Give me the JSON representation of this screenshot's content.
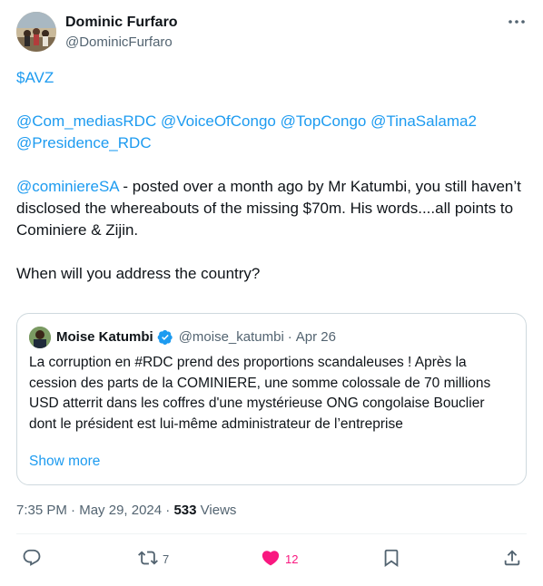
{
  "author": {
    "display_name": "Dominic Furfaro",
    "handle": "@DominicFurfaro"
  },
  "tweet": {
    "cashtag": "$AVZ",
    "mentions": [
      "@Com_mediasRDC",
      "@VoiceOfCongo",
      "@TopCongo",
      "@TinaSalama2",
      "@Presidence_RDC"
    ],
    "reply_mention": "@cominiereSA",
    "para3_text": " - posted over a month ago by Mr Katumbi, you still haven’t disclosed the whereabouts of the missing $70m. His words....all points to Cominiere & Zijin.",
    "para4_text": "When will you address the country?"
  },
  "quote": {
    "display_name": "Moise Katumbi",
    "handle": "@moise_katumbi",
    "separator": "·",
    "date": "Apr 26",
    "text": "La corruption en #RDC prend des proportions scandaleuses ! Après la cession des parts de la COMINIERE, une somme colossale de 70 millions USD atterrit dans les coffres d'une mystérieuse ONG congolaise Bouclier dont le président est lui-même administrateur de l’entreprise",
    "show_more": "Show more"
  },
  "meta": {
    "time": "7:35 PM",
    "separator": "·",
    "date": "May 29, 2024",
    "separator2": "·",
    "views_count": "533",
    "views_label": "Views"
  },
  "actions": {
    "reply_icon": "reply-icon",
    "retweet_icon": "retweet-icon",
    "retweet_count": "7",
    "like_icon": "heart-icon",
    "like_count": "12",
    "bookmark_icon": "bookmark-icon",
    "share_icon": "share-icon"
  },
  "colors": {
    "link": "#1d9bf0",
    "secondary_text": "#536471",
    "like": "#f91880",
    "verified": "#1d9bf0"
  }
}
